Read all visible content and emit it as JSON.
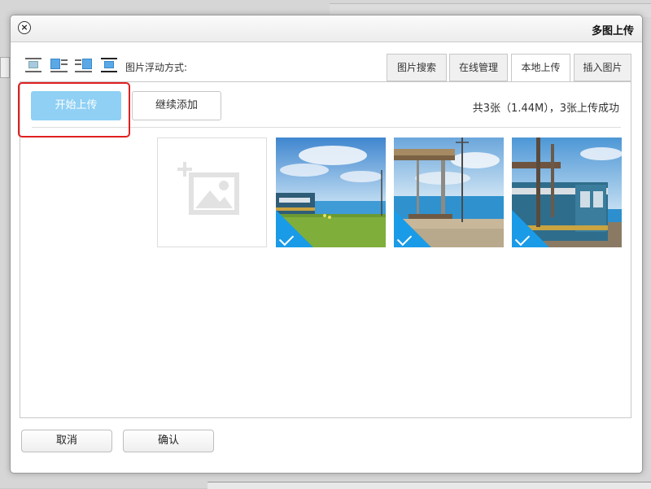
{
  "dialog": {
    "title": "多图上传",
    "close_symbol": "×"
  },
  "toolbar": {
    "float_label": "图片浮动方式:",
    "float_options": [
      "none",
      "left",
      "right",
      "center"
    ]
  },
  "tabs": [
    {
      "label": "插入图片",
      "active": false
    },
    {
      "label": "本地上传",
      "active": true
    },
    {
      "label": "在线管理",
      "active": false
    },
    {
      "label": "图片搜索",
      "active": false
    }
  ],
  "upload": {
    "status_text": "共3张（1.44M），3张上传成功",
    "continue_label": "继续添加",
    "start_label": "开始上传",
    "images": [
      {
        "name": "train-at-platform-photo",
        "uploaded": true
      },
      {
        "name": "seaside-station-photo",
        "uploaded": true
      },
      {
        "name": "train-by-sea-photo",
        "uploaded": true
      }
    ]
  },
  "footer": {
    "confirm_label": "确认",
    "cancel_label": "取消"
  },
  "colors": {
    "accent": "#1a9be8",
    "start_button": "#8fd0f4",
    "highlight": "#e02020"
  }
}
